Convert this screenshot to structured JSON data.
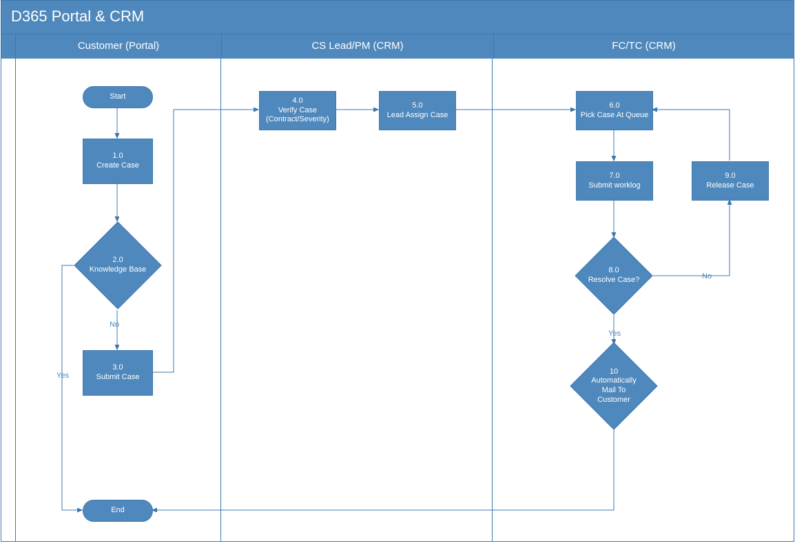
{
  "title": "D365 Portal & CRM",
  "lanes": {
    "l1": "Customer (Portal)",
    "l2": "CS Lead/PM (CRM)",
    "l3": "FC/TC (CRM)"
  },
  "nodes": {
    "start": "Start",
    "n1a": "1.0",
    "n1b": "Create Case",
    "n2a": "2.0",
    "n2b": "Knowledge Base",
    "n3a": "3.0",
    "n3b": "Submit Case",
    "n4a": "4.0",
    "n4b": "Verify Case",
    "n4c": "(Contract/Severity)",
    "n5a": "5.0",
    "n5b": "Lead Assign Case",
    "n6a": "6.0",
    "n6b": "Pick Case At Queue",
    "n7a": "7.0",
    "n7b": "Submit worklog",
    "n8a": "8.0",
    "n8b": "Resolve Case?",
    "n9a": "9.0",
    "n9b": "Release Case",
    "n10a": "10",
    "n10b": "Automatically",
    "n10c": "Mail To",
    "n10d": "Customer",
    "end": "End"
  },
  "labels": {
    "yes1": "Yes",
    "no1": "No",
    "yes2": "Yes",
    "no2": "No"
  },
  "chart_data": {
    "type": "swimlane-flowchart",
    "title": "D365 Portal & CRM",
    "lanes": [
      "Customer (Portal)",
      "CS Lead/PM (CRM)",
      "FC/TC (CRM)"
    ],
    "nodes": [
      {
        "id": "start",
        "lane": 0,
        "type": "terminator",
        "label": "Start"
      },
      {
        "id": "1",
        "lane": 0,
        "type": "process",
        "label": "1.0 Create Case"
      },
      {
        "id": "2",
        "lane": 0,
        "type": "decision",
        "label": "2.0 Knowledge Base"
      },
      {
        "id": "3",
        "lane": 0,
        "type": "process",
        "label": "3.0 Submit Case"
      },
      {
        "id": "4",
        "lane": 1,
        "type": "process",
        "label": "4.0 Verify Case (Contract/Severity)"
      },
      {
        "id": "5",
        "lane": 1,
        "type": "process",
        "label": "5.0 Lead Assign Case"
      },
      {
        "id": "6",
        "lane": 2,
        "type": "process",
        "label": "6.0 Pick Case At Queue"
      },
      {
        "id": "7",
        "lane": 2,
        "type": "process",
        "label": "7.0 Submit worklog"
      },
      {
        "id": "8",
        "lane": 2,
        "type": "decision",
        "label": "8.0 Resolve Case?"
      },
      {
        "id": "9",
        "lane": 2,
        "type": "process",
        "label": "9.0 Release Case"
      },
      {
        "id": "10",
        "lane": 2,
        "type": "decision",
        "label": "10 Automatically Mail To Customer"
      },
      {
        "id": "end",
        "lane": 0,
        "type": "terminator",
        "label": "End"
      }
    ],
    "edges": [
      {
        "from": "start",
        "to": "1"
      },
      {
        "from": "1",
        "to": "2"
      },
      {
        "from": "2",
        "to": "end",
        "label": "Yes"
      },
      {
        "from": "2",
        "to": "3",
        "label": "No"
      },
      {
        "from": "3",
        "to": "4"
      },
      {
        "from": "4",
        "to": "5"
      },
      {
        "from": "5",
        "to": "6"
      },
      {
        "from": "6",
        "to": "7"
      },
      {
        "from": "7",
        "to": "8"
      },
      {
        "from": "8",
        "to": "9",
        "label": "No"
      },
      {
        "from": "9",
        "to": "6"
      },
      {
        "from": "8",
        "to": "10",
        "label": "Yes"
      },
      {
        "from": "10",
        "to": "end"
      }
    ]
  }
}
